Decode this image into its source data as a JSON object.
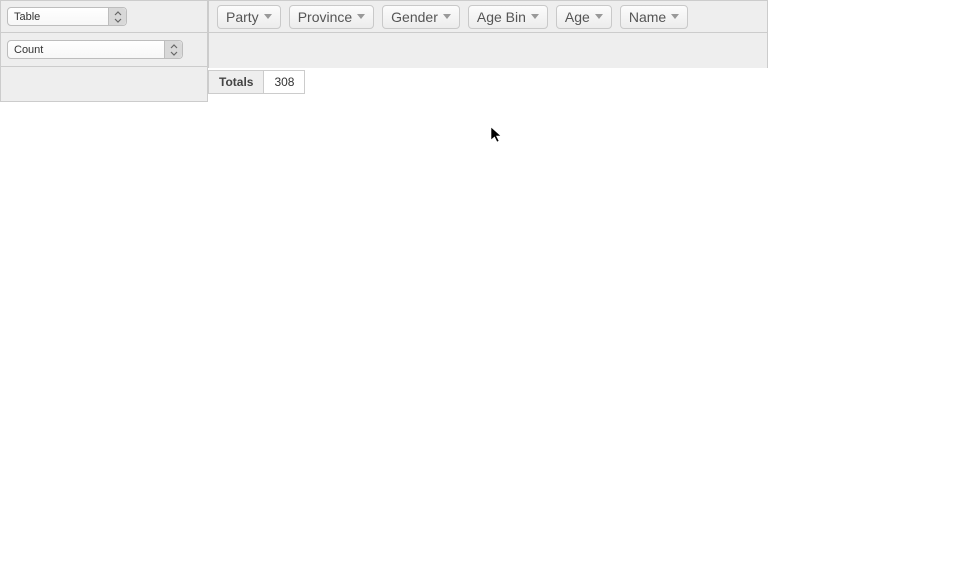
{
  "renderer": {
    "selected": "Table"
  },
  "aggregator": {
    "selected": "Count"
  },
  "attrs": {
    "party": "Party",
    "province": "Province",
    "gender": "Gender",
    "agebin": "Age Bin",
    "age": "Age",
    "name": "Name"
  },
  "results": {
    "totals_label": "Totals",
    "totals_value": "308"
  }
}
